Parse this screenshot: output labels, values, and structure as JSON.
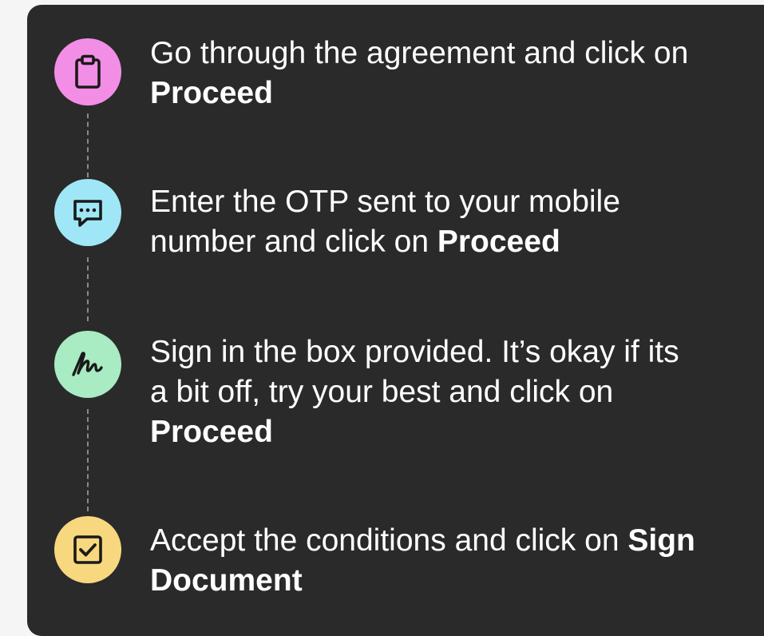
{
  "steps": [
    {
      "icon": "clipboard-icon",
      "color": "#f38ee6",
      "line1": "Go through the agreement and click on",
      "line2_plain": "",
      "line2_bold": "Proceed",
      "line3_bold": ""
    },
    {
      "icon": "chat-bubble-icon",
      "color": "#9fe7f6",
      "line1": "Enter the OTP sent to your mobile",
      "line2_plain": "number and click on ",
      "line2_bold": "Proceed",
      "line3_bold": ""
    },
    {
      "icon": "signature-icon",
      "color": "#a9ebc3",
      "line1": "Sign in the box provided. It’s okay if its",
      "line2_plain": "a bit off, try your best and click on",
      "line2_bold": "",
      "line3_bold": "Proceed"
    },
    {
      "icon": "checkbox-icon",
      "color": "#f7d87e",
      "line1_plain": "Accept the conditions and click on ",
      "line1_bold": "Sign",
      "line2_bold": "Document"
    }
  ]
}
